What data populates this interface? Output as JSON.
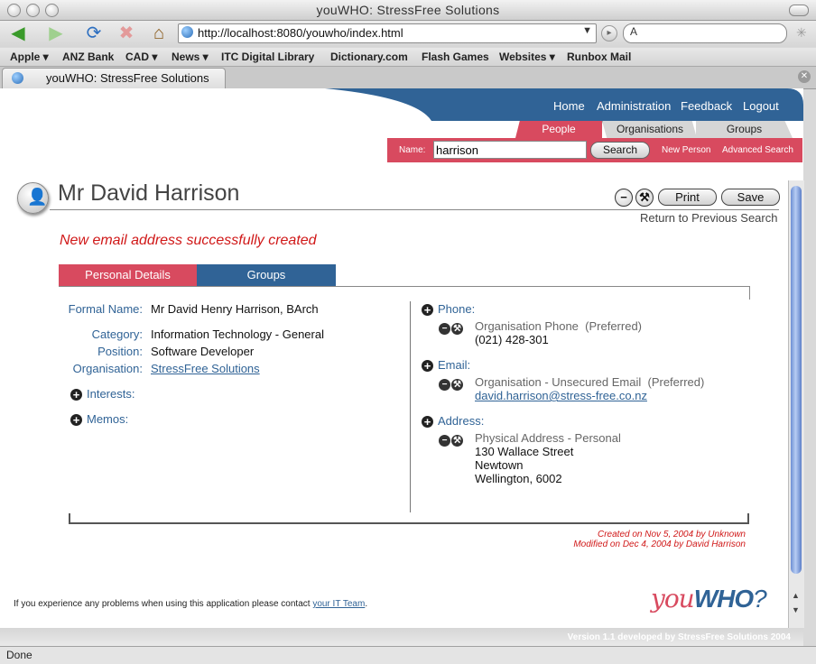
{
  "browser": {
    "window_title": "youWHO: StressFree Solutions",
    "url": "http://localhost:8080/youwho/index.html",
    "search_glyph": "A",
    "bookmarks": [
      "Apple ▾",
      "ANZ Bank",
      "CAD ▾",
      "News ▾",
      "ITC Digital Library",
      "Dictionary.com",
      "Flash Games",
      "Websites ▾",
      "Runbox Mail"
    ],
    "tab_label": "youWHO: StressFree Solutions",
    "status": "Done"
  },
  "app": {
    "top_nav": [
      "Home",
      "Administration",
      "Feedback",
      "Logout"
    ],
    "section_tabs": [
      "People",
      "Organisations",
      "Groups"
    ],
    "search": {
      "label": "Name:",
      "value": "harrison",
      "button": "Search",
      "new_person": "New Person",
      "advanced": "Advanced Search"
    }
  },
  "person": {
    "name": "Mr David Harrison",
    "print_label": "Print",
    "save_label": "Save",
    "return_link": "Return to Previous Search",
    "message": "New email address successfully created",
    "tabs": [
      "Personal Details",
      "Groups"
    ],
    "details": {
      "formal_name_label": "Formal Name:",
      "formal_name": "Mr David Henry Harrison, BArch",
      "category_label": "Category:",
      "category": "Information Technology - General",
      "position_label": "Position:",
      "position": "Software Developer",
      "organisation_label": "Organisation:",
      "organisation": "StressFree Solutions",
      "interests_label": "Interests:",
      "memos_label": "Memos:"
    },
    "contact": {
      "phone_label": "Phone:",
      "phone_type": "Organisation Phone",
      "phone_pref": "(Preferred)",
      "phone_value": "(021) 428-301",
      "email_label": "Email:",
      "email_type": "Organisation - Unsecured Email",
      "email_pref": "(Preferred)",
      "email_value": "david.harrison@stress-free.co.nz",
      "address_label": "Address:",
      "address_type": "Physical Address - Personal",
      "address_line1": "130 Wallace Street",
      "address_line2": "Newtown",
      "address_line3": "Wellington, 6002"
    },
    "created": "Created on Nov 5, 2004 by Unknown",
    "modified": "Modified on Dec 4, 2004 by David Harrison"
  },
  "footer": {
    "text": "If you experience any problems when using this application please contact ",
    "link": "your IT Team",
    "suffix": ".",
    "logo_you": "you",
    "logo_who": "WHO",
    "version": "Version 1.1 developed by StressFree Solutions 2004"
  },
  "colors": {
    "brand_blue": "#306396",
    "brand_red": "#d84a5f",
    "message_red": "#d01818"
  }
}
